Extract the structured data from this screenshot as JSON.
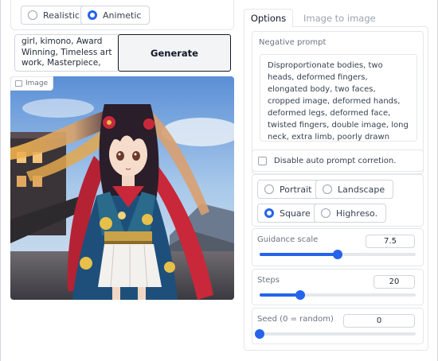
{
  "model": {
    "options": [
      {
        "label": "Realistic",
        "checked": false
      },
      {
        "label": "Animetic",
        "checked": true
      }
    ]
  },
  "prompt": {
    "value": "girl, kimono,  Award Winning, Timeless art work, Masterpiece,"
  },
  "generate": {
    "label": "Generate"
  },
  "image": {
    "label": "Image"
  },
  "tabs": [
    {
      "label": "Options",
      "active": true
    },
    {
      "label": "Image to image",
      "active": false
    }
  ],
  "negative_prompt": {
    "label": "Negative prompt",
    "value": "Disproportionate bodies, two heads, deformed fingers, elongated body, two faces, cropped image, deformed hands, deformed legs, deformed face, twisted fingers, double image, long neck, extra limb, poorly drawn hands, missing limb, grainy, blurry, poorly drawn face, mutation,"
  },
  "auto_correct": {
    "label": "Disable auto prompt corretion.",
    "checked": false
  },
  "size": {
    "options": [
      {
        "label": "Portrait",
        "checked": false
      },
      {
        "label": "Landscape",
        "checked": false
      },
      {
        "label": "Square",
        "checked": true
      },
      {
        "label": "Highreso.",
        "checked": false
      }
    ]
  },
  "guidance": {
    "label": "Guidance scale",
    "value": "7.5",
    "fraction": 0.5
  },
  "steps": {
    "label": "Steps",
    "value": "20",
    "fraction": 0.26
  },
  "seed": {
    "label": "Seed (0 = random)",
    "value": "0",
    "fraction": 0.0
  },
  "colors": {
    "accent": "#2563eb",
    "border": "#e5e7eb"
  }
}
